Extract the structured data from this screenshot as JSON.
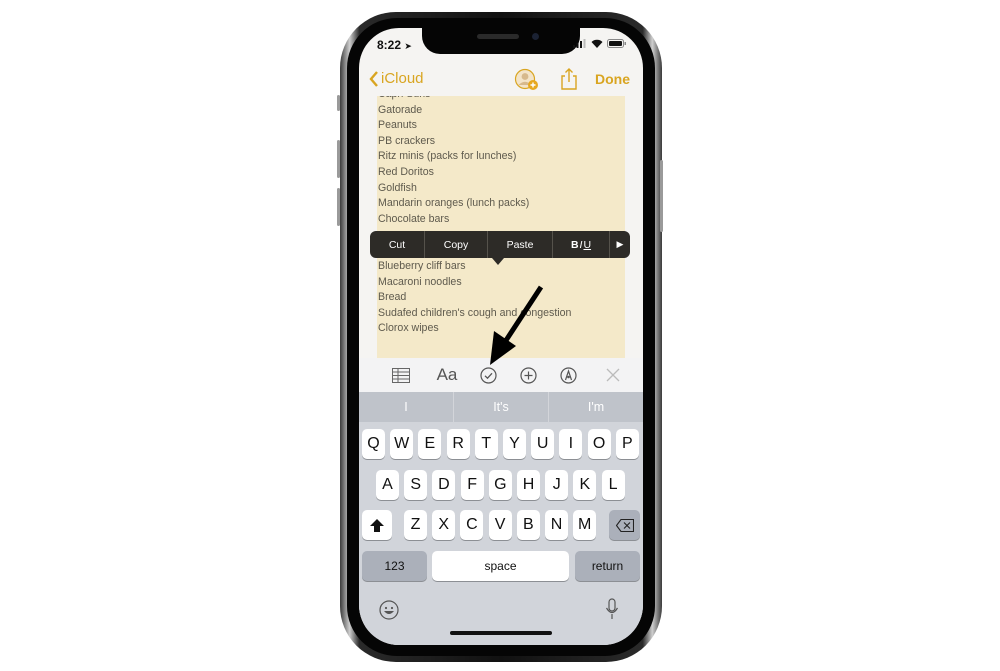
{
  "status_bar": {
    "time": "8:22",
    "location_icon": "location-arrow-icon",
    "signal_icon": "cellular-signal-icon",
    "wifi_icon": "wifi-icon",
    "battery_icon": "battery-icon"
  },
  "nav": {
    "back_label": "iCloud",
    "back_icon": "chevron-left-icon",
    "add_people_icon": "add-person-icon",
    "share_icon": "share-icon",
    "done_label": "Done",
    "accent_color": "#d9a521"
  },
  "note": {
    "lines_top": [
      "Capri Suns",
      "Gatorade",
      "Peanuts",
      "PB crackers",
      "Ritz minis (packs for lunches)",
      "Red Doritos",
      "Goldfish",
      "Mandarin oranges (lunch packs)",
      "Chocolate bars"
    ],
    "lines_bottom": [
      "Blueberry cliff bars",
      "Macaroni noodles",
      "Bread",
      "Sudafed children's cough and congestion",
      "Clorox wipes"
    ],
    "highlight_color": "#f4e9c9"
  },
  "edit_menu": {
    "cut": "Cut",
    "copy": "Copy",
    "paste": "Paste",
    "format": "BIU",
    "more_icon": "play-right-icon"
  },
  "toolbar": {
    "table_icon": "table-icon",
    "text_format": "Aa",
    "checklist_icon": "checklist-icon",
    "add_icon": "plus-circle-icon",
    "markup_icon": "markup-pen-icon",
    "close_icon": "close-icon"
  },
  "suggestions": [
    "I",
    "It's",
    "I'm"
  ],
  "keyboard": {
    "row1": [
      "Q",
      "W",
      "E",
      "R",
      "T",
      "Y",
      "U",
      "I",
      "O",
      "P"
    ],
    "row2": [
      "A",
      "S",
      "D",
      "F",
      "G",
      "H",
      "J",
      "K",
      "L"
    ],
    "row3": [
      "Z",
      "X",
      "C",
      "V",
      "B",
      "N",
      "M"
    ],
    "shift_icon": "shift-icon",
    "delete_icon": "backspace-icon",
    "numbers_label": "123",
    "space_label": "space",
    "return_label": "return",
    "emoji_icon": "emoji-icon",
    "mic_icon": "microphone-icon"
  },
  "annotation": {
    "arrow_icon": "annotation-arrow-icon"
  }
}
